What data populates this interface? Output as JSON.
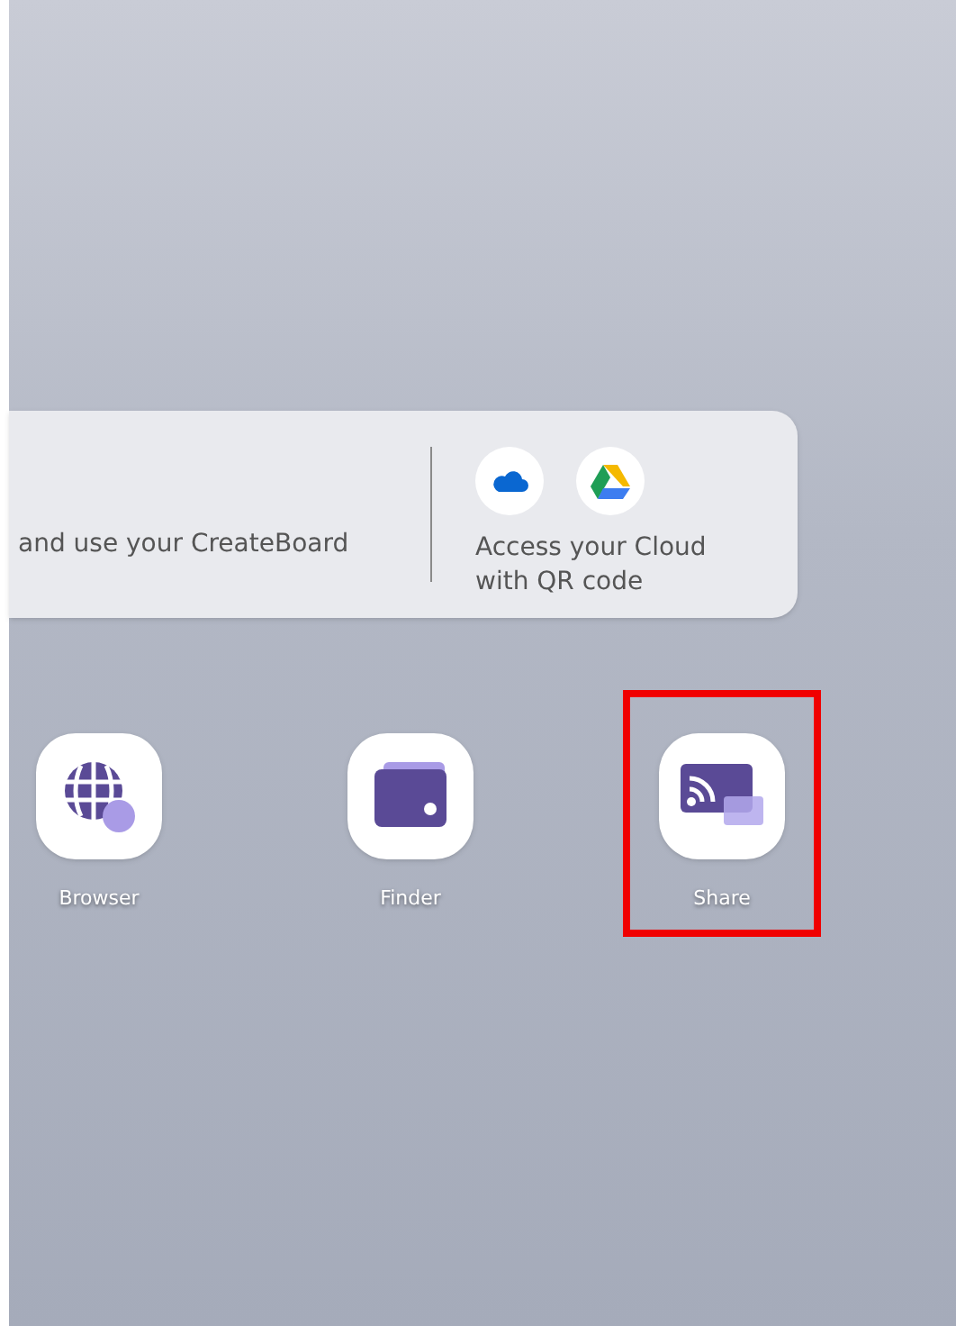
{
  "cloud_card": {
    "left_text": "and use your CreateBoard",
    "right_text": "Access your Cloud with QR code",
    "services": [
      {
        "kind": "onedrive"
      },
      {
        "kind": "drive"
      }
    ]
  },
  "apps": [
    {
      "label": "Browser",
      "kind": "browser",
      "highlighted": false
    },
    {
      "label": "Finder",
      "kind": "finder",
      "highlighted": false
    },
    {
      "label": "Share",
      "kind": "share",
      "highlighted": true
    }
  ]
}
